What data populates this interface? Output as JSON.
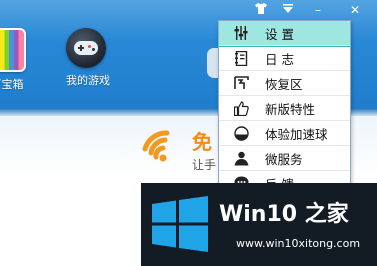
{
  "toolbar": {
    "items": [
      {
        "label": "百宝箱",
        "icon": "treasure-box-icon"
      },
      {
        "label": "我的游戏",
        "icon": "gamepad-icon"
      }
    ]
  },
  "window_controls": {
    "icons": [
      "skin-icon",
      "main-menu-icon",
      "minimize-icon",
      "close-icon"
    ],
    "minimize_glyph": "–",
    "close_glyph": "✕"
  },
  "promo": {
    "title": "免",
    "subtitle": "让手"
  },
  "menu": {
    "items": [
      {
        "label": "设  置",
        "icon": "settings-sliders-icon",
        "selected": true
      },
      {
        "label": "日  志",
        "icon": "log-book-icon",
        "selected": false
      },
      {
        "label": "恢复区",
        "icon": "restore-icon",
        "selected": false
      },
      {
        "label": "新版特性",
        "icon": "thumbs-up-icon",
        "selected": false
      },
      {
        "label": "体验加速球",
        "icon": "speed-ball-icon",
        "selected": false
      },
      {
        "label": "微服务",
        "icon": "service-person-icon",
        "selected": false
      },
      {
        "label": "反  馈",
        "icon": "feedback-icon",
        "selected": false
      }
    ]
  },
  "watermark": {
    "title": "Win10 之家",
    "url": "www.win10xitong.com"
  },
  "colors": {
    "titlebar": "#2585d3",
    "menu_selected": "#9ee6e0",
    "promo_orange": "#f28c1b",
    "watermark_bg": "#131b24",
    "win_logo_blue": "#1fa4e8"
  }
}
